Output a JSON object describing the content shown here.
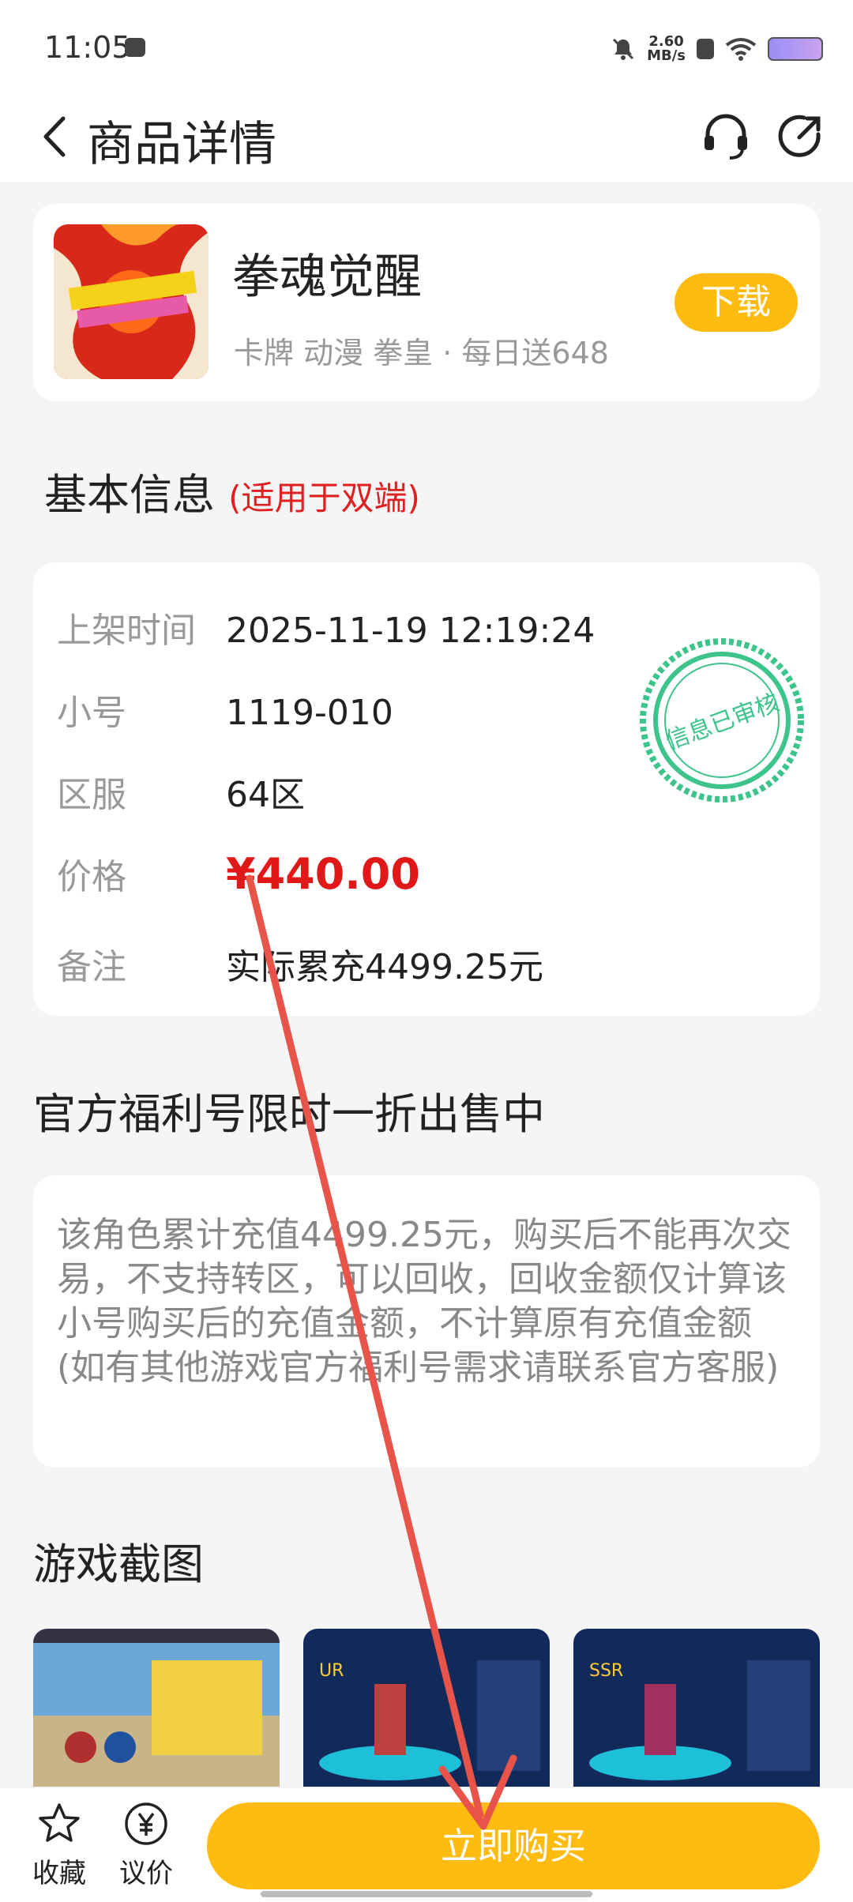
{
  "status_bar": {
    "time": "11:05",
    "net_speed_value": "2.60",
    "net_speed_unit": "MB/s"
  },
  "header": {
    "title": "商品详情",
    "back_icon": "chevron-left-icon",
    "service_icon": "headset-icon",
    "share_icon": "share-icon"
  },
  "game": {
    "name": "拳魂觉醒",
    "tags": "卡牌 动漫 拳皇 · 每日送648",
    "download_label": "下载"
  },
  "basic_info": {
    "title": "基本信息",
    "note": "(适用于双端)",
    "stamp_text": "信息已审核",
    "rows": [
      {
        "key": "上架时间",
        "value": "2025-11-19 12:19:24"
      },
      {
        "key": "小号",
        "value": "1119-010"
      },
      {
        "key": "区服",
        "value": "64区"
      },
      {
        "key": "价格",
        "value": "¥440.00"
      },
      {
        "key": "备注",
        "value": "实际累充4499.25元"
      }
    ]
  },
  "promo": {
    "title": "官方福利号限时一折出售中",
    "description": "该角色累计充值4499.25元，购买后不能再次交易，不支持转区，可以回收，回收金额仅计算该小号购买后的充值金额，不计算原有充值金额(如有其他游戏官方福利号需求请联系官方客服)"
  },
  "screenshots": {
    "title": "游戏截图"
  },
  "bottom_bar": {
    "favorite_label": "收藏",
    "bargain_label": "议价",
    "buy_label": "立即购买"
  }
}
